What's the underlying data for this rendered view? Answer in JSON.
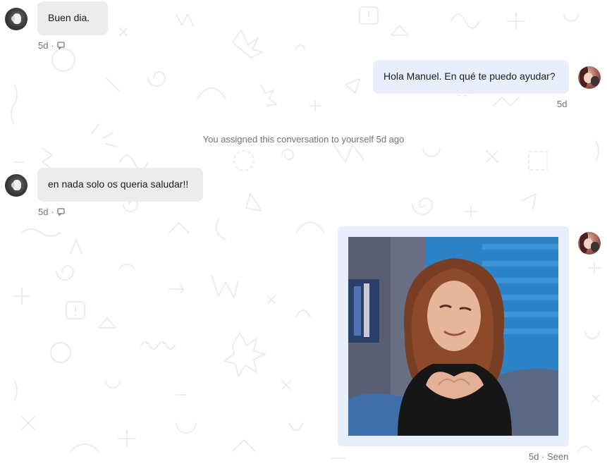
{
  "conversation": {
    "messages": [
      {
        "id": "m1",
        "direction": "incoming",
        "text": "Buen dia.",
        "time": "5d",
        "separator": "·",
        "status_icon": "note-icon"
      },
      {
        "id": "m2",
        "direction": "outgoing",
        "text": "Hola Manuel. En qué te puedo ayudar?",
        "time": "5d"
      },
      {
        "id": "m3",
        "direction": "incoming",
        "text": "en nada solo os queria saludar!!",
        "time": "5d",
        "separator": "·",
        "status_icon": "note-icon"
      },
      {
        "id": "m4",
        "direction": "outgoing",
        "type": "gif",
        "meta": "5d · Seen"
      }
    ],
    "system_event": "You assigned this conversation to yourself 5d ago"
  },
  "avatars": {
    "customer": "customer-avatar",
    "agent": "agent-avatar"
  },
  "colors": {
    "incoming_bubble": "#ececec",
    "outgoing_bubble": "#e8eefc",
    "meta_text": "#737376",
    "pattern": "#ededed"
  }
}
